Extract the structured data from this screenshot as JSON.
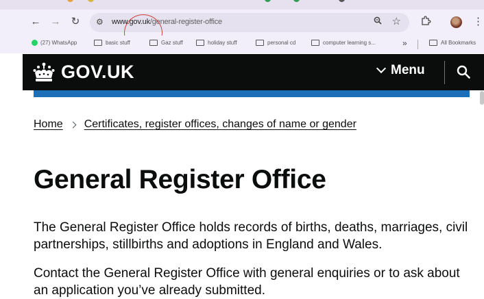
{
  "browser": {
    "address_bar": {
      "domain": "www.gov.uk",
      "path": "/general-register-office"
    },
    "bookmarks": [
      {
        "label": "(27) WhatsApp",
        "icon": "whatsapp-icon"
      },
      {
        "label": "basic stuff",
        "icon": "folder-icon"
      },
      {
        "label": "Gaz stuff",
        "icon": "folder-icon"
      },
      {
        "label": "holiday stuff",
        "icon": "folder-icon"
      },
      {
        "label": "personal cd",
        "icon": "folder-icon"
      },
      {
        "label": "computer learning s...",
        "icon": "folder-icon"
      }
    ],
    "bookmarks_overflow": "»",
    "all_bookmarks": "All Bookmarks"
  },
  "header": {
    "logo_text": "GOV.UK",
    "menu_label": "Menu"
  },
  "breadcrumbs": {
    "home": "Home",
    "section": "Certificates, register offices, changes of name or gender"
  },
  "page": {
    "title": "General Register Office",
    "intro": "The General Register Office holds records of births, deaths, marriages, civil partnerships, stillbirths and adoptions in England and Wales.",
    "contact": "Contact the General Register Office with general enquiries or to ask about an application you’ve already submitted."
  },
  "colors": {
    "header_bg": "#0b0c0c",
    "accent_blue": "#1d70b8",
    "annotation_red": "#c9443f"
  }
}
